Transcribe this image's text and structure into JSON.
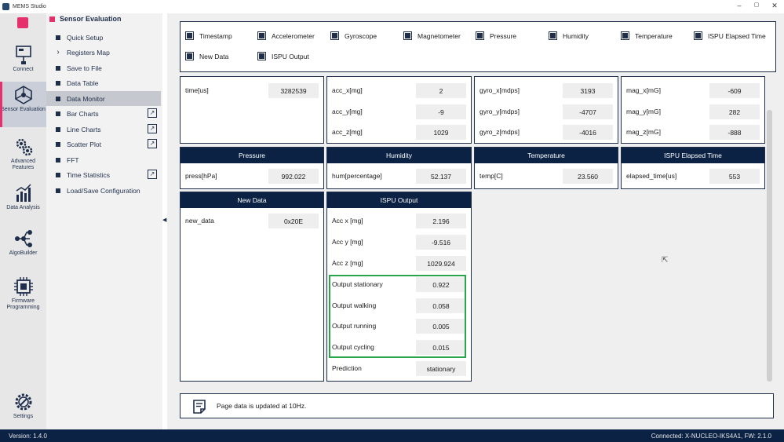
{
  "window": {
    "title": "MEMS Studio",
    "controls": [
      "–",
      "▢",
      "✕"
    ]
  },
  "rail": [
    {
      "label": "Connect",
      "icon": "connect-icon"
    },
    {
      "label": "Sensor Evaluation",
      "icon": "sensor-evaluation-icon",
      "active": true
    },
    {
      "label": "Advanced Features",
      "icon": "advanced-features-icon"
    },
    {
      "label": "Data Analysis",
      "icon": "data-analysis-icon"
    },
    {
      "label": "AlgoBuilder",
      "icon": "algobuilder-icon"
    },
    {
      "label": "Firmware Programming",
      "icon": "firmware-programming-icon"
    },
    {
      "label": "Settings",
      "icon": "settings-icon"
    }
  ],
  "nav": {
    "title": "Sensor Evaluation",
    "items": [
      {
        "label": "Quick Setup",
        "marker": "bullet"
      },
      {
        "label": "Registers Map",
        "marker": "chevron"
      },
      {
        "label": "Save to File",
        "marker": "bullet"
      },
      {
        "label": "Data Table",
        "marker": "bullet"
      },
      {
        "label": "Data Monitor",
        "marker": "bullet",
        "active": true
      },
      {
        "label": "Bar Charts",
        "marker": "bullet",
        "external": true
      },
      {
        "label": "Line Charts",
        "marker": "bullet",
        "external": true
      },
      {
        "label": "Scatter Plot",
        "marker": "bullet",
        "external": true
      },
      {
        "label": "FFT",
        "marker": "bullet"
      },
      {
        "label": "Time Statistics",
        "marker": "bullet",
        "external": true
      },
      {
        "label": "Load/Save Configuration",
        "marker": "bullet"
      }
    ]
  },
  "checkboxes": [
    {
      "label": "Timestamp",
      "checked": true
    },
    {
      "label": "Accelerometer",
      "checked": true
    },
    {
      "label": "Gyroscope",
      "checked": true
    },
    {
      "label": "Magnetometer",
      "checked": true
    },
    {
      "label": "Pressure",
      "checked": true
    },
    {
      "label": "Humidity",
      "checked": true
    },
    {
      "label": "Temperature",
      "checked": true
    },
    {
      "label": "ISPU Elapsed Time",
      "checked": true
    },
    {
      "label": "New Data",
      "checked": true
    },
    {
      "label": "ISPU Output",
      "checked": true
    }
  ],
  "panels": {
    "timestamp": {
      "rows": [
        {
          "key": "time[us]",
          "value": "3282539"
        }
      ]
    },
    "accelerometer": {
      "rows": [
        {
          "key": "acc_x[mg]",
          "value": "2"
        },
        {
          "key": "acc_y[mg]",
          "value": "-9"
        },
        {
          "key": "acc_z[mg]",
          "value": "1029"
        }
      ]
    },
    "gyroscope": {
      "rows": [
        {
          "key": "gyro_x[mdps]",
          "value": "3193"
        },
        {
          "key": "gyro_y[mdps]",
          "value": "-4707"
        },
        {
          "key": "gyro_z[mdps]",
          "value": "-4016"
        }
      ]
    },
    "magnetometer": {
      "rows": [
        {
          "key": "mag_x[mG]",
          "value": "-609"
        },
        {
          "key": "mag_y[mG]",
          "value": "282"
        },
        {
          "key": "mag_z[mG]",
          "value": "-888"
        }
      ]
    },
    "pressure": {
      "title": "Pressure",
      "rows": [
        {
          "key": "press[hPa]",
          "value": "992.022"
        }
      ]
    },
    "humidity": {
      "title": "Humidity",
      "rows": [
        {
          "key": "hum[percentage]",
          "value": "52.137"
        }
      ]
    },
    "temperature": {
      "title": "Temperature",
      "rows": [
        {
          "key": "temp[C]",
          "value": "23.560"
        }
      ]
    },
    "elapsed": {
      "title": "ISPU Elapsed Time",
      "rows": [
        {
          "key": "elapsed_time[us]",
          "value": "553"
        }
      ]
    },
    "newdata": {
      "title": "New Data",
      "rows": [
        {
          "key": "new_data",
          "value": "0x20E"
        }
      ]
    },
    "ispu": {
      "title": "ISPU Output",
      "rows": [
        {
          "key": "Acc x [mg]",
          "value": "2.196"
        },
        {
          "key": "Acc y [mg]",
          "value": "-9.516"
        },
        {
          "key": "Acc z [mg]",
          "value": "1029.924"
        },
        {
          "key": "Output stationary",
          "value": "0.922"
        },
        {
          "key": "Output walking",
          "value": "0.058"
        },
        {
          "key": "Output running",
          "value": "0.005"
        },
        {
          "key": "Output cycling",
          "value": "0.015"
        },
        {
          "key": "Prediction",
          "value": "stationary"
        }
      ]
    }
  },
  "info": {
    "text": "Page data is updated at 10Hz."
  },
  "status": {
    "version": "Version: 1.4.0",
    "connection": "Connected:  X-NUCLEO-IKS4A1, FW: 2.1.0"
  },
  "colors": {
    "accent": "#e6306b",
    "navy": "#0b2245",
    "highlight": "#29a64a"
  }
}
